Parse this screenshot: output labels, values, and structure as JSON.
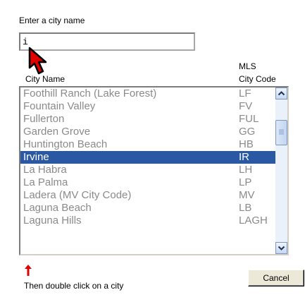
{
  "dialog": {
    "prompt_label": "Enter a city name",
    "input_value": "i",
    "hint": "Then double click on a city",
    "cancel_label": "Cancel"
  },
  "columns": {
    "mls": "MLS",
    "name": "City Name",
    "code": "City Code"
  },
  "cities": [
    {
      "name": "Foothill Ranch (Lake Forest)",
      "code": "LF"
    },
    {
      "name": "Fountain Valley",
      "code": "FV"
    },
    {
      "name": "Fullerton",
      "code": "FUL"
    },
    {
      "name": "Garden Grove",
      "code": "GG"
    },
    {
      "name": "Huntington Beach",
      "code": "HB"
    },
    {
      "name": "Irvine",
      "code": "IR"
    },
    {
      "name": "La Habra",
      "code": "LH"
    },
    {
      "name": "La Palma",
      "code": "LP"
    },
    {
      "name": "Ladera (MV City Code)",
      "code": "MV"
    },
    {
      "name": "Laguna Beach",
      "code": "LB"
    },
    {
      "name": "Laguna Hills",
      "code": "LAGH"
    }
  ],
  "selected_city_index": 5,
  "colors": {
    "selection": "#2b58a3",
    "row_text": "#8a8a8a",
    "arrow": "#e00000"
  },
  "icons": {
    "cursor": "mouse-pointer-icon",
    "hint_arrow": "arrow-up-icon",
    "scroll_up": "chevron-up-icon",
    "scroll_down": "chevron-down-icon"
  }
}
